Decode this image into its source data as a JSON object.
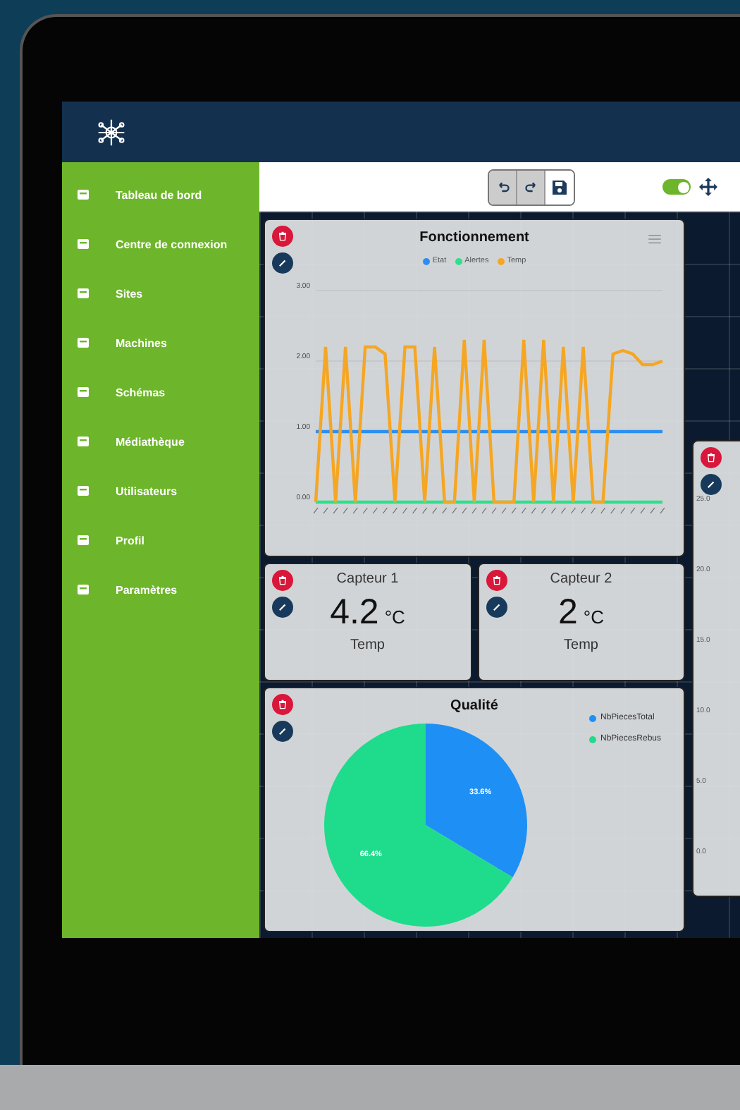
{
  "sidebar": {
    "items": [
      {
        "label": "Tableau de bord"
      },
      {
        "label": "Centre de connexion"
      },
      {
        "label": "Sites"
      },
      {
        "label": "Machines"
      },
      {
        "label": "Schémas"
      },
      {
        "label": "Médiathèque"
      },
      {
        "label": "Utilisateurs"
      },
      {
        "label": "Profil"
      },
      {
        "label": "Paramètres"
      }
    ]
  },
  "toolbar": {
    "edit_mode_on": true
  },
  "line_card": {
    "title": "Fonctionnement",
    "chart_data": {
      "type": "line",
      "ylim": [
        0,
        3
      ],
      "yticks": [
        {
          "value": 0,
          "label": "0.00"
        },
        {
          "value": 1,
          "label": "1.00"
        },
        {
          "value": 2,
          "label": "2.00"
        },
        {
          "value": 3,
          "label": "3.00"
        }
      ],
      "series": [
        {
          "name": "Etat",
          "color": "#2a8ff0",
          "values": [
            1,
            1,
            1,
            1,
            1,
            1,
            1,
            1,
            1,
            1,
            1,
            1,
            1,
            1,
            1,
            1,
            1,
            1,
            1,
            1,
            1,
            1,
            1,
            1,
            1,
            1,
            1,
            1,
            1,
            1,
            1,
            1,
            1,
            1,
            1,
            1
          ]
        },
        {
          "name": "Alertes",
          "color": "#2ee08a",
          "values": [
            0,
            0,
            0,
            0,
            0,
            0,
            0,
            0,
            0,
            0,
            0,
            0,
            0,
            0,
            0,
            0,
            0,
            0,
            0,
            0,
            0,
            0,
            0,
            0,
            0,
            0,
            0,
            0,
            0,
            0,
            0,
            0,
            0,
            0,
            0,
            0
          ]
        },
        {
          "name": "Temp",
          "color": "#f5a623",
          "values": [
            0,
            2.2,
            0,
            2.2,
            0,
            2.2,
            2.2,
            2.1,
            0,
            2.2,
            2.2,
            0,
            2.2,
            0,
            0,
            2.3,
            0,
            2.3,
            0,
            0,
            0,
            2.3,
            0,
            2.3,
            0,
            2.2,
            0,
            2.2,
            0,
            0,
            2.1,
            2.15,
            2.1,
            1.95,
            1.95,
            2.0
          ]
        }
      ]
    }
  },
  "sensors": [
    {
      "title": "Capteur 1",
      "value": "4.2",
      "unit": "°C",
      "label": "Temp"
    },
    {
      "title": "Capteur 2",
      "value": "2",
      "unit": "°C",
      "label": "Temp"
    }
  ],
  "pie_card": {
    "title": "Qualité",
    "chart_data": {
      "type": "pie",
      "categories": [
        "NbPiecesTotal",
        "NbPiecesRebus"
      ],
      "values": [
        33.6,
        66.4
      ],
      "value_labels": [
        "33.6%",
        "66.4%"
      ],
      "colors": [
        "#1e8ff5",
        "#1fdc8c"
      ]
    }
  },
  "right_card": {
    "y_labels": [
      "25.0",
      "20.0",
      "15.0",
      "10.0",
      "5.0",
      "0.0"
    ]
  }
}
